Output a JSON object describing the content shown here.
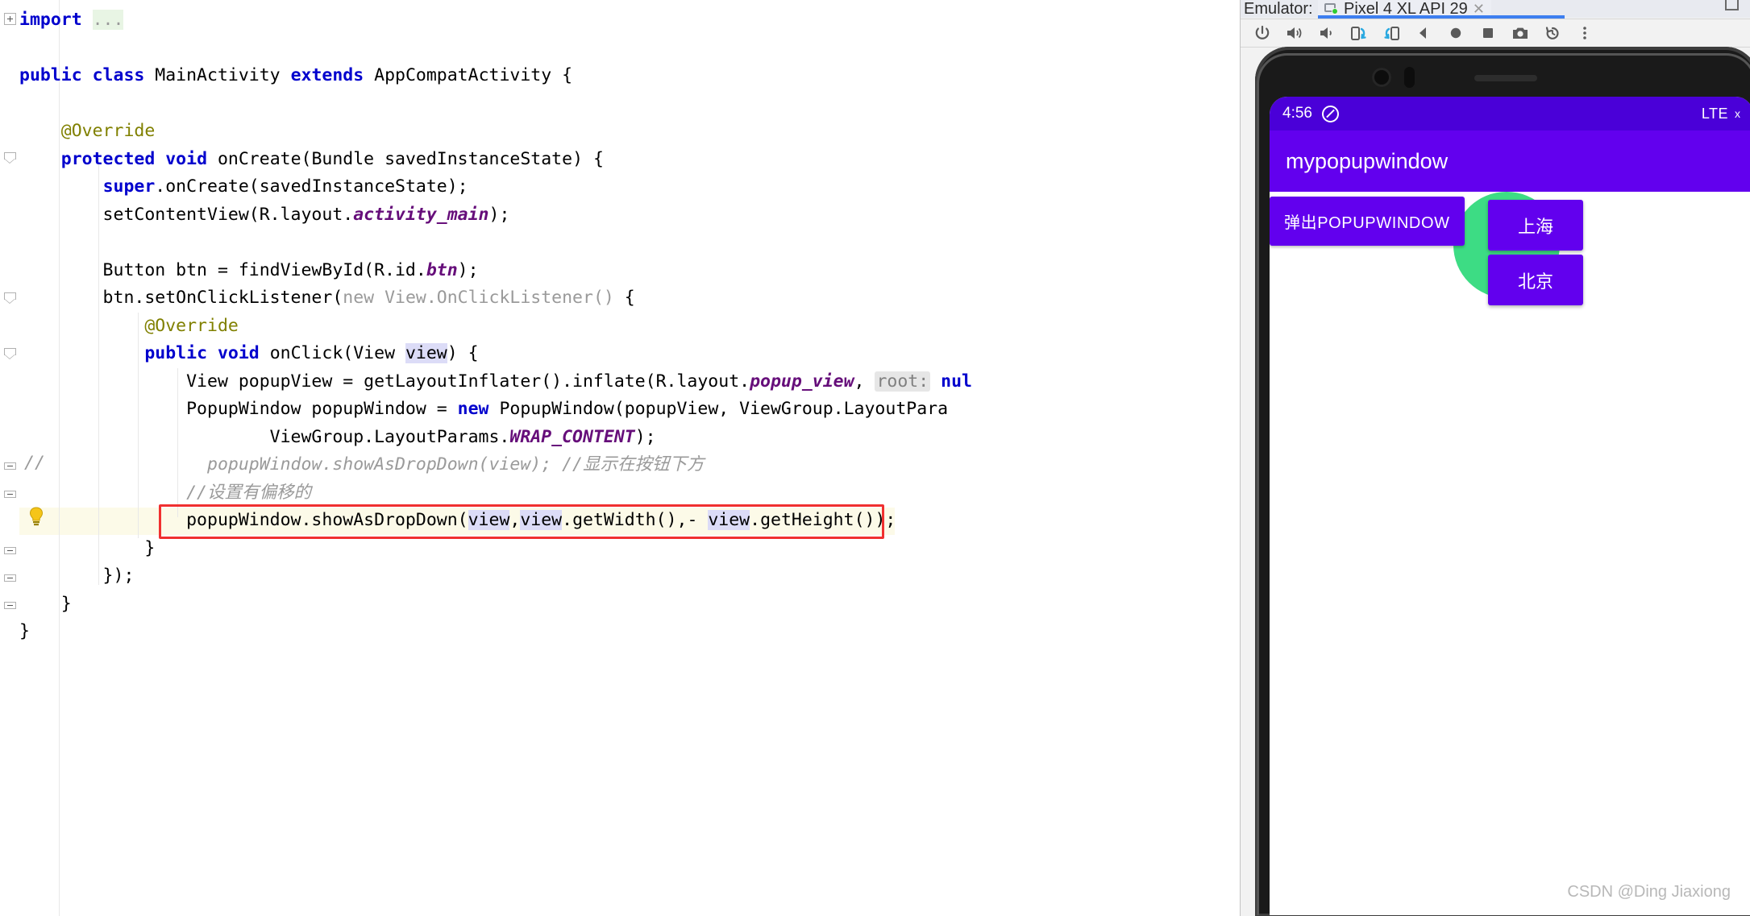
{
  "editor": {
    "lines": [
      [
        {
          "t": "import ",
          "c": "kw"
        },
        {
          "t": "...",
          "c": "imp gry"
        }
      ],
      [],
      [
        {
          "t": "public ",
          "c": "kw"
        },
        {
          "t": "class ",
          "c": "kw"
        },
        {
          "t": "MainActivity ",
          "c": "blk"
        },
        {
          "t": "extends ",
          "c": "kw"
        },
        {
          "t": "AppCompatActivity {",
          "c": "blk"
        }
      ],
      [],
      [
        {
          "t": "    @Override",
          "c": "anno"
        }
      ],
      [
        {
          "t": "    ",
          "c": "blk"
        },
        {
          "t": "protected ",
          "c": "kw"
        },
        {
          "t": "void ",
          "c": "kw"
        },
        {
          "t": "onCreate(Bundle savedInstanceState) {",
          "c": "blk"
        }
      ],
      [
        {
          "t": "        ",
          "c": "blk"
        },
        {
          "t": "super",
          "c": "kw"
        },
        {
          "t": ".onCreate(savedInstanceState);",
          "c": "blk"
        }
      ],
      [
        {
          "t": "        setContentView(R.layout.",
          "c": "blk"
        },
        {
          "t": "activity_main",
          "c": "fld"
        },
        {
          "t": ");",
          "c": "blk"
        }
      ],
      [],
      [
        {
          "t": "        Button btn = findViewById(R.id.",
          "c": "blk"
        },
        {
          "t": "btn",
          "c": "fld"
        },
        {
          "t": ");",
          "c": "blk"
        }
      ],
      [
        {
          "t": "        btn.setOnClickListener(",
          "c": "blk"
        },
        {
          "t": "new ",
          "c": "gry"
        },
        {
          "t": "View.OnClickListener() ",
          "c": "gry"
        },
        {
          "t": "{",
          "c": "blk"
        }
      ],
      [
        {
          "t": "            @Override",
          "c": "anno"
        }
      ],
      [
        {
          "t": "            ",
          "c": "blk"
        },
        {
          "t": "public ",
          "c": "kw"
        },
        {
          "t": "void ",
          "c": "kw"
        },
        {
          "t": "onClick(View ",
          "c": "blk"
        },
        {
          "t": "view",
          "c": "blk hl"
        },
        {
          "t": ") {",
          "c": "blk"
        }
      ],
      [
        {
          "t": "                View popupView = getLayoutInflater().inflate(R.layout.",
          "c": "blk"
        },
        {
          "t": "popup_view",
          "c": "fld"
        },
        {
          "t": ", ",
          "c": "blk"
        },
        {
          "t": "root:",
          "c": "hint"
        },
        {
          "t": " ",
          "c": "blk"
        },
        {
          "t": "nul",
          "c": "kw"
        }
      ],
      [
        {
          "t": "                PopupWindow popupWindow = ",
          "c": "blk"
        },
        {
          "t": "new ",
          "c": "kw"
        },
        {
          "t": "PopupWindow(popupView, ViewGroup.LayoutPara",
          "c": "blk"
        }
      ],
      [
        {
          "t": "                        ViewGroup.LayoutParams.",
          "c": "blk"
        },
        {
          "t": "WRAP_CONTENT",
          "c": "fld"
        },
        {
          "t": ");",
          "c": "blk"
        }
      ],
      [
        {
          "t": "                  popupWindow.showAsDropDown(view); ",
          "c": "cmt"
        },
        {
          "t": "//显示在按钮下方",
          "c": "cmt"
        }
      ],
      [
        {
          "t": "                //设置有偏移的",
          "c": "cmt"
        }
      ],
      [
        {
          "t": "                popupWindow.showAsDropDown(",
          "c": "blk"
        },
        {
          "t": "view",
          "c": "blk hl"
        },
        {
          "t": ",",
          "c": "blk"
        },
        {
          "t": "view",
          "c": "blk hl"
        },
        {
          "t": ".getWidth(),- ",
          "c": "blk"
        },
        {
          "t": "view",
          "c": "blk hl"
        },
        {
          "t": ".getHeight());",
          "c": "blk"
        }
      ],
      [
        {
          "t": "            }",
          "c": "blk"
        }
      ],
      [
        {
          "t": "        });",
          "c": "blk"
        }
      ],
      [
        {
          "t": "    }",
          "c": "blk"
        }
      ],
      [
        {
          "t": "}",
          "c": "blk"
        }
      ]
    ],
    "comment_prefix_line17": "//",
    "lightbulb_icon": "lightbulb-icon"
  },
  "emulator": {
    "panel_label": "Emulator:",
    "tab_title": "Pixel 4 XL API 29",
    "tab_close_glyph": "✕",
    "device_icon": "device-icon",
    "toolbar_buttons": [
      {
        "name": "power-icon",
        "label": "Power"
      },
      {
        "name": "volume-up-icon",
        "label": "Volume Up"
      },
      {
        "name": "volume-down-icon",
        "label": "Volume Down"
      },
      {
        "name": "rotate-left-icon",
        "label": "Rotate Left"
      },
      {
        "name": "rotate-right-icon",
        "label": "Rotate Right"
      },
      {
        "name": "back-icon",
        "label": "Back"
      },
      {
        "name": "home-icon",
        "label": "Home"
      },
      {
        "name": "overview-icon",
        "label": "Overview"
      },
      {
        "name": "screenshot-icon",
        "label": "Take Screenshot"
      },
      {
        "name": "snapshot-icon",
        "label": "Snapshot"
      },
      {
        "name": "more-icon",
        "label": "More"
      }
    ],
    "window_button": "maximize-icon",
    "accent_color": "#3d7ef0"
  },
  "device": {
    "status_bar": {
      "time": "4:56",
      "dnd_icon": "do-not-disturb-icon",
      "network": "LTE",
      "signal_x": "x"
    },
    "app_bar_title": "mypopupwindow",
    "primary_color": "#6200ee",
    "status_color": "#4a00d8",
    "android_green": "#3ddc84",
    "main_button_label": "弹出POPUPWINDOW",
    "popup_items": [
      {
        "label": "上海"
      },
      {
        "label": "北京"
      }
    ]
  },
  "watermark": "CSDN @Ding Jiaxiong"
}
